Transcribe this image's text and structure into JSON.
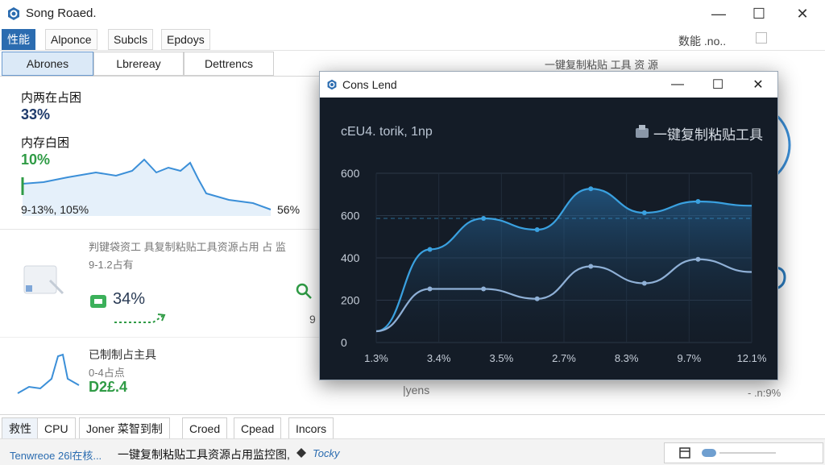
{
  "window": {
    "title": "Song Roaed.",
    "minimize": "—",
    "maximize": "☐",
    "close": "✕"
  },
  "menu": {
    "items": [
      "性能",
      "Alponce",
      "Subcls",
      "Epdoys"
    ],
    "right_label": "数能 .no.."
  },
  "tabs": [
    "Abrones",
    "Lbrereay",
    "Dettrencs"
  ],
  "side_header": "一键复制粘贴 工具 资 源",
  "metrics": {
    "m1_label": "内两在占困",
    "m1_value": "33%",
    "m2_label": "内存白困",
    "m2_value": "10%",
    "range": "9-13%, 105%",
    "end": "56%"
  },
  "cards": {
    "c1_title": "判键袋资工 具复制粘贴工具资源占用 占 监",
    "c1_sub": "9-1.2占有",
    "c1_value": "34%",
    "c2_title": "已制制占主具",
    "c2_sub": "0-4占点",
    "c2_value": "D2£.4",
    "c3_value": "9",
    "c4_text": "|yens",
    "c5_text": "- .n:9%"
  },
  "popup": {
    "title": "Cons Lend",
    "subtitle": "cEU4. torik, 1np",
    "brand": "一键复制粘贴工具",
    "min": "—",
    "max": "☐",
    "close": "✕"
  },
  "chart_data": {
    "type": "line",
    "title": "cEU4. torik, 1np",
    "categories": [
      "1.3%",
      "3.4%",
      "3.5%",
      "2.7%",
      "8.3%",
      "9.7%",
      "12.1%"
    ],
    "y_ticks": [
      "600",
      "600",
      "400",
      "200",
      "0"
    ],
    "series": [
      {
        "values": [
          40,
          330,
          440,
          400,
          545,
          460,
          500,
          485
        ]
      },
      {
        "values": [
          40,
          190,
          190,
          155,
          270,
          210,
          295,
          250
        ]
      }
    ],
    "ylim": [
      0,
      600
    ],
    "grid": true
  },
  "bottom_tabs": [
    "救性",
    "CPU",
    "Joner 菜智到制",
    "Croed",
    "Cpead",
    "Incors"
  ],
  "status": {
    "left": "Tenwreoe 26l在核...",
    "middle": "一键复制粘贴工具资源占用监控图,",
    "right": "Tocky"
  },
  "colors": {
    "accent": "#2b6cb0",
    "line1": "#3aa1e0",
    "line2": "#8fb0d6",
    "green": "#2f9b45"
  }
}
